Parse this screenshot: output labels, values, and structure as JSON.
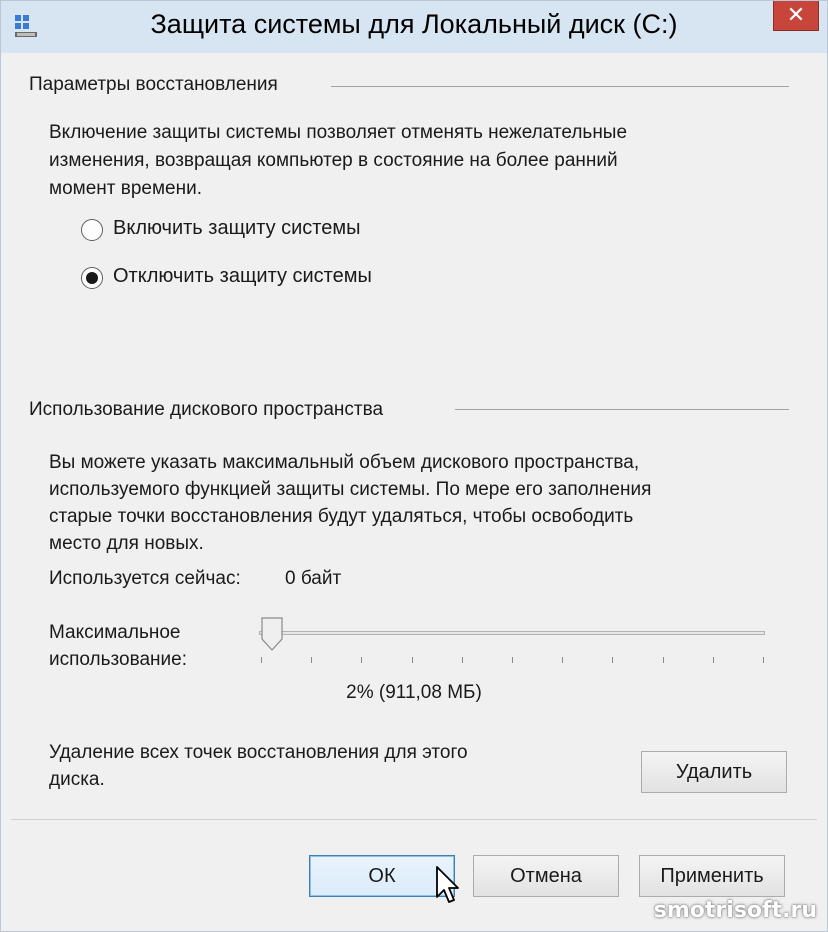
{
  "window": {
    "title": "Защита системы для Локальный диск (C:)",
    "close_label": "✕"
  },
  "restore_settings": {
    "heading": "Параметры восстановления",
    "description_lines": [
      "Включение защиты системы позволяет отменять нежелательные",
      "изменения, возвращая компьютер в состояние на более ранний",
      "момент времени."
    ],
    "options": [
      {
        "label": "Включить защиту системы",
        "checked": false
      },
      {
        "label": "Отключить защиту системы",
        "checked": true
      }
    ]
  },
  "disk_usage": {
    "heading": "Использование дискового пространства",
    "description_lines": [
      "Вы можете указать максимальный объем дискового пространства,",
      "используемого функцией защиты системы. По мере его заполнения",
      "старые точки восстановления будут удаляться, чтобы освободить",
      "место для новых."
    ],
    "current_label": "Используется сейчас:",
    "current_value": "0 байт",
    "max_label_line1": "Максимальное",
    "max_label_line2": "использование:",
    "slider_fraction": 0.02,
    "slider_value_text": "2% (911,08 МБ)",
    "delete_text_line1": "Удаление всех точек восстановления для этого",
    "delete_text_line2": "диска.",
    "delete_button": "Удалить"
  },
  "footer": {
    "ok": "ОК",
    "cancel": "Отмена",
    "apply": "Применить"
  },
  "watermark": "smotrisoft.ru",
  "colors": {
    "titlebar": "#d7e4f1",
    "close": "#c7453a",
    "default_button_border": "#3c7fb1"
  }
}
